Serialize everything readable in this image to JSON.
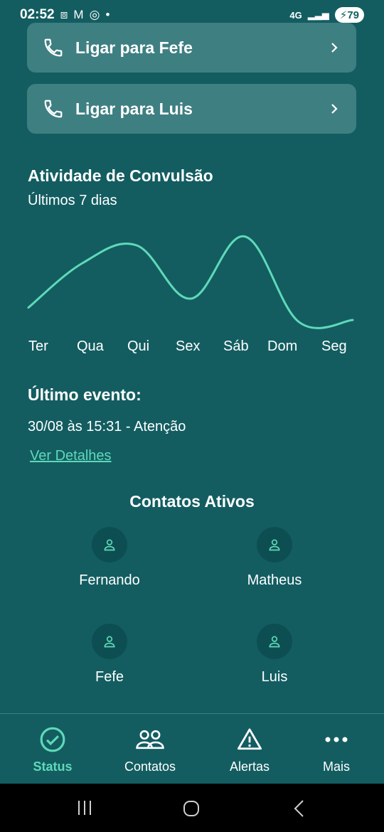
{
  "status_bar": {
    "time": "02:52",
    "network": "4G",
    "battery": "79"
  },
  "calls": [
    {
      "label": "Ligar para Fefe"
    },
    {
      "label": "Ligar para Luis"
    }
  ],
  "activity": {
    "title": "Atividade de Convulsão",
    "subtitle": "Últimos 7 dias"
  },
  "chart_data": {
    "type": "line",
    "categories": [
      "Ter",
      "Qua",
      "Qui",
      "Sex",
      "Sáb",
      "Dom",
      "Seg"
    ],
    "values": [
      1.3,
      3.8,
      4.8,
      1.8,
      5.3,
      0.5,
      0.6
    ],
    "ylim": [
      0,
      6
    ],
    "grid": false,
    "color": "#5fd9b9"
  },
  "last_event": {
    "title": "Último evento:",
    "text": "30/08 às 15:31 - Atenção",
    "link": "Ver Detalhes"
  },
  "contacts": {
    "title": "Contatos Ativos",
    "items": [
      {
        "name": "Fernando"
      },
      {
        "name": "Matheus"
      },
      {
        "name": "Fefe"
      },
      {
        "name": "Luis"
      }
    ]
  },
  "nav": {
    "items": [
      {
        "label": "Status",
        "icon": "check-circle-icon",
        "active": true
      },
      {
        "label": "Contatos",
        "icon": "people-icon"
      },
      {
        "label": "Alertas",
        "icon": "warning-icon"
      },
      {
        "label": "Mais",
        "icon": "more-icon"
      }
    ]
  },
  "colors": {
    "background": "#135d61",
    "card": "#3e7f82",
    "accent": "#5fd9b9"
  }
}
